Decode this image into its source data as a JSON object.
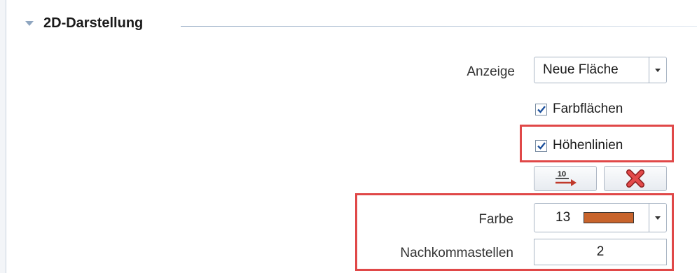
{
  "section": {
    "title": "2D-Darstellung"
  },
  "anzeige": {
    "label": "Anzeige",
    "value": "Neue Fläche"
  },
  "farbflaechen": {
    "label": "Farbflächen",
    "checked": true
  },
  "hoehenlinien": {
    "label": "Höhenlinien",
    "checked": true
  },
  "buttons": {
    "label_number": "10"
  },
  "farbe": {
    "label": "Farbe",
    "number": "13",
    "swatch_color": "#c8642c"
  },
  "nachkommastellen": {
    "label": "Nachkommastellen",
    "value": "2"
  },
  "highlight_color": "#e04848"
}
